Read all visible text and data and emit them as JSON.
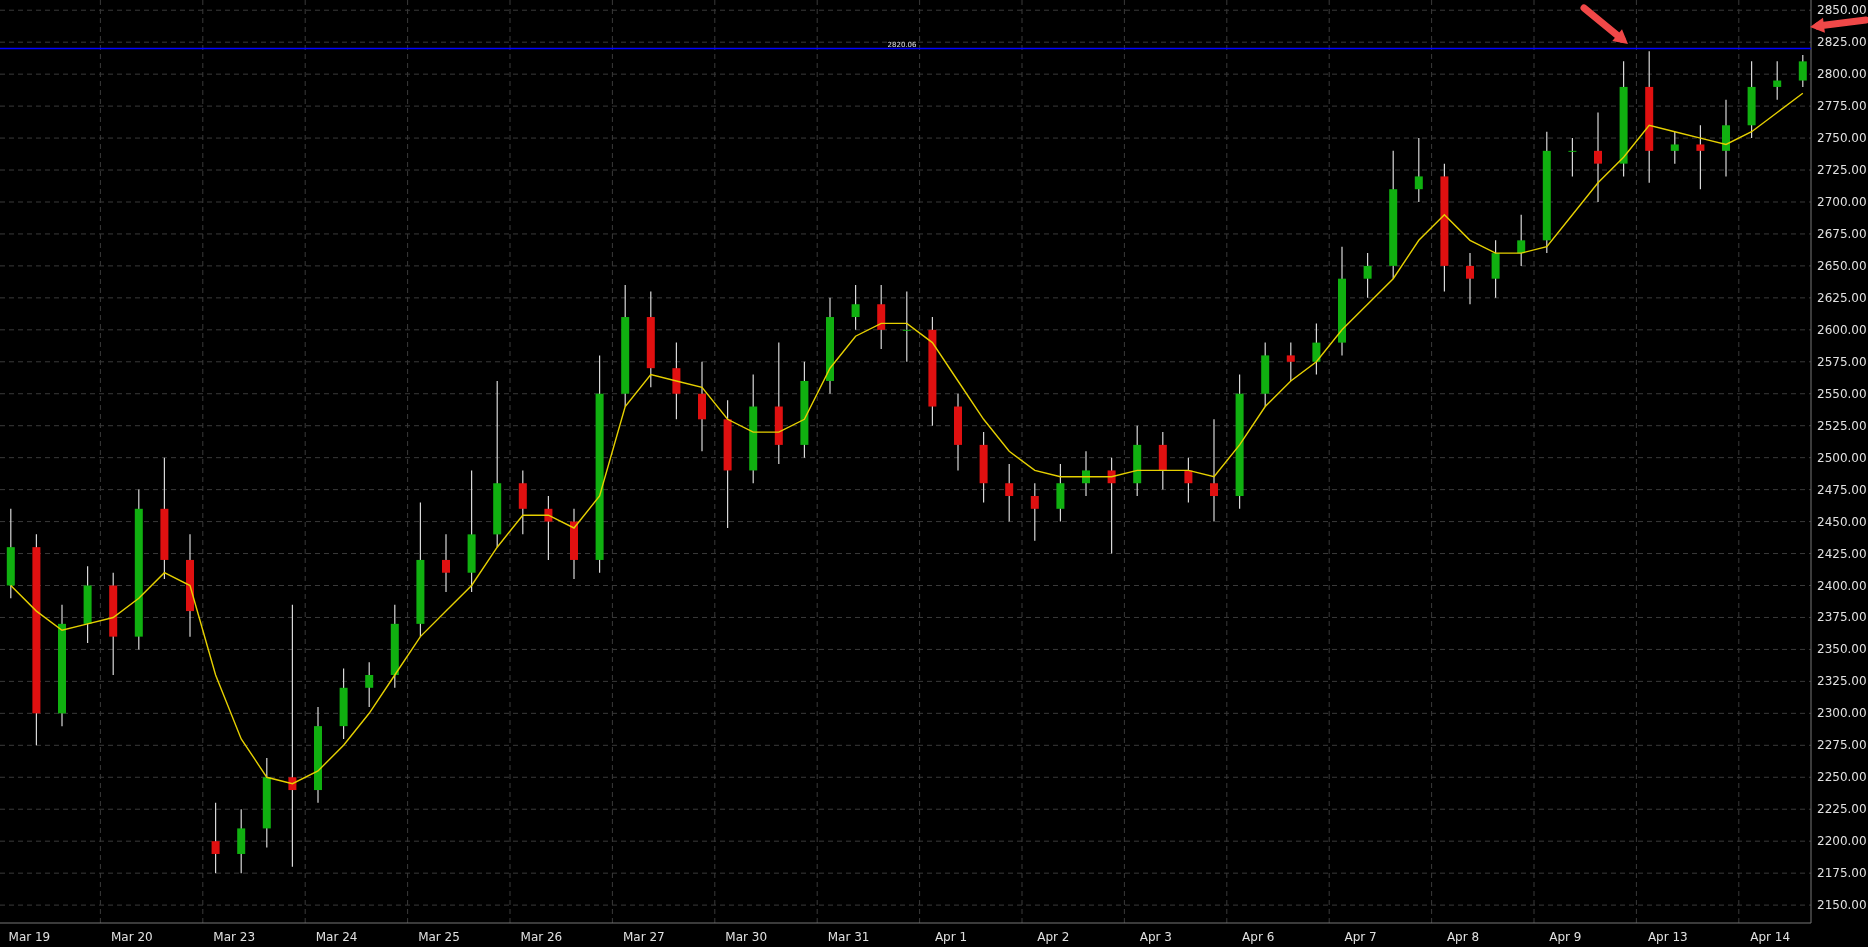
{
  "chart": {
    "chart_data": {
      "type": "candlestick",
      "grid": true,
      "ylim": [
        2136,
        2858
      ],
      "yticks": [
        {
          "value": 2150,
          "label": "2150.00"
        },
        {
          "value": 2175,
          "label": "2175.00"
        },
        {
          "value": 2200,
          "label": "2200.00"
        },
        {
          "value": 2225,
          "label": "2225.00"
        },
        {
          "value": 2250,
          "label": "2250.00"
        },
        {
          "value": 2275,
          "label": "2275.00"
        },
        {
          "value": 2300,
          "label": "2300.00"
        },
        {
          "value": 2325,
          "label": "2325.00"
        },
        {
          "value": 2350,
          "label": "2350.00"
        },
        {
          "value": 2375,
          "label": "2375.00"
        },
        {
          "value": 2400,
          "label": "2400.00"
        },
        {
          "value": 2425,
          "label": "2425.00"
        },
        {
          "value": 2450,
          "label": "2450.00"
        },
        {
          "value": 2475,
          "label": "2475.00"
        },
        {
          "value": 2500,
          "label": "2500.00"
        },
        {
          "value": 2525,
          "label": "2525.00"
        },
        {
          "value": 2550,
          "label": "2550.00"
        },
        {
          "value": 2575,
          "label": "2575.00"
        },
        {
          "value": 2600,
          "label": "2600.00"
        },
        {
          "value": 2625,
          "label": "2625.00"
        },
        {
          "value": 2650,
          "label": "2650.00"
        },
        {
          "value": 2675,
          "label": "2675.00"
        },
        {
          "value": 2700,
          "label": "2700.00"
        },
        {
          "value": 2725,
          "label": "2725.00"
        },
        {
          "value": 2750,
          "label": "2750.00"
        },
        {
          "value": 2775,
          "label": "2775.00"
        },
        {
          "value": 2800,
          "label": "2800.00"
        },
        {
          "value": 2825,
          "label": "2825.00"
        },
        {
          "value": 2850,
          "label": "2850.00"
        }
      ],
      "categories": [
        null,
        "Mar 19",
        null,
        null,
        null,
        "Mar 20",
        null,
        null,
        null,
        "Mar 23",
        null,
        null,
        null,
        "Mar 24",
        null,
        null,
        null,
        "Mar 25",
        null,
        null,
        null,
        "Mar 26",
        null,
        null,
        null,
        "Mar 27",
        null,
        null,
        null,
        "Mar 30",
        null,
        null,
        null,
        "Mar 31",
        null,
        null,
        null,
        "Apr 1",
        null,
        null,
        null,
        "Apr 2",
        null,
        null,
        null,
        "Apr 3",
        null,
        null,
        null,
        "Apr 6",
        null,
        null,
        null,
        "Apr 7",
        null,
        null,
        null,
        "Apr 8",
        null,
        null,
        null,
        "Apr 9",
        null,
        null,
        null,
        "Apr 13",
        null,
        null,
        null,
        "Apr 14",
        null
      ],
      "ohlc": [
        [
          2400,
          2460,
          2390,
          2430
        ],
        [
          2430,
          2440,
          2275,
          2300
        ],
        [
          2300,
          2385,
          2290,
          2370
        ],
        [
          2370,
          2415,
          2355,
          2400
        ],
        [
          2400,
          2410,
          2330,
          2360
        ],
        [
          2360,
          2475,
          2350,
          2460
        ],
        [
          2460,
          2500,
          2405,
          2420
        ],
        [
          2420,
          2440,
          2360,
          2380
        ],
        [
          2200,
          2230,
          2175,
          2190
        ],
        [
          2190,
          2225,
          2175,
          2210
        ],
        [
          2210,
          2265,
          2195,
          2250
        ],
        [
          2250,
          2385,
          2180,
          2240
        ],
        [
          2240,
          2305,
          2230,
          2290
        ],
        [
          2290,
          2335,
          2280,
          2320
        ],
        [
          2320,
          2340,
          2305,
          2330
        ],
        [
          2330,
          2385,
          2320,
          2370
        ],
        [
          2370,
          2465,
          2360,
          2420
        ],
        [
          2420,
          2440,
          2395,
          2410
        ],
        [
          2410,
          2490,
          2395,
          2440
        ],
        [
          2440,
          2560,
          2430,
          2480
        ],
        [
          2480,
          2490,
          2440,
          2460
        ],
        [
          2460,
          2470,
          2420,
          2450
        ],
        [
          2450,
          2460,
          2405,
          2420
        ],
        [
          2420,
          2580,
          2410,
          2550
        ],
        [
          2550,
          2635,
          2540,
          2610
        ],
        [
          2610,
          2630,
          2555,
          2570
        ],
        [
          2570,
          2590,
          2530,
          2550
        ],
        [
          2550,
          2575,
          2505,
          2530
        ],
        [
          2530,
          2545,
          2445,
          2490
        ],
        [
          2490,
          2565,
          2480,
          2540
        ],
        [
          2540,
          2590,
          2495,
          2510
        ],
        [
          2510,
          2575,
          2500,
          2560
        ],
        [
          2560,
          2625,
          2550,
          2610
        ],
        [
          2610,
          2635,
          2600,
          2620
        ],
        [
          2620,
          2635,
          2585,
          2600
        ],
        [
          2600,
          2630,
          2575,
          2600
        ],
        [
          2600,
          2610,
          2525,
          2540
        ],
        [
          2540,
          2550,
          2490,
          2510
        ],
        [
          2510,
          2520,
          2465,
          2480
        ],
        [
          2480,
          2495,
          2450,
          2470
        ],
        [
          2470,
          2480,
          2435,
          2460
        ],
        [
          2460,
          2495,
          2450,
          2480
        ],
        [
          2480,
          2505,
          2470,
          2490
        ],
        [
          2490,
          2500,
          2425,
          2480
        ],
        [
          2480,
          2525,
          2470,
          2510
        ],
        [
          2510,
          2520,
          2475,
          2490
        ],
        [
          2490,
          2500,
          2465,
          2480
        ],
        [
          2480,
          2530,
          2450,
          2470
        ],
        [
          2470,
          2565,
          2460,
          2550
        ],
        [
          2550,
          2590,
          2540,
          2580
        ],
        [
          2580,
          2590,
          2560,
          2575
        ],
        [
          2575,
          2605,
          2565,
          2590
        ],
        [
          2590,
          2665,
          2580,
          2640
        ],
        [
          2640,
          2660,
          2625,
          2650
        ],
        [
          2650,
          2740,
          2640,
          2710
        ],
        [
          2710,
          2750,
          2700,
          2720
        ],
        [
          2720,
          2730,
          2630,
          2650
        ],
        [
          2650,
          2660,
          2620,
          2640
        ],
        [
          2640,
          2670,
          2625,
          2660
        ],
        [
          2660,
          2690,
          2650,
          2670
        ],
        [
          2670,
          2755,
          2660,
          2740
        ],
        [
          2740,
          2750,
          2720,
          2740
        ],
        [
          2740,
          2770,
          2700,
          2730
        ],
        [
          2730,
          2810,
          2720,
          2790
        ],
        [
          2790,
          2818,
          2715,
          2740
        ],
        [
          2740,
          2755,
          2730,
          2745
        ],
        [
          2745,
          2760,
          2710,
          2740
        ],
        [
          2740,
          2780,
          2720,
          2760
        ],
        [
          2760,
          2810,
          2750,
          2790
        ],
        [
          2790,
          2810,
          2780,
          2795
        ],
        [
          2795,
          2815,
          2790,
          2810
        ]
      ],
      "series": [
        {
          "type": "line",
          "color": "#e6d000",
          "values": [
            2400,
            2380,
            2365,
            2370,
            2375,
            2390,
            2410,
            2400,
            2330,
            2280,
            2250,
            2245,
            2255,
            2275,
            2300,
            2330,
            2360,
            2380,
            2400,
            2430,
            2455,
            2455,
            2445,
            2470,
            2540,
            2565,
            2560,
            2555,
            2530,
            2520,
            2520,
            2530,
            2570,
            2595,
            2605,
            2605,
            2590,
            2560,
            2530,
            2505,
            2490,
            2485,
            2485,
            2485,
            2490,
            2490,
            2490,
            2485,
            2510,
            2540,
            2560,
            2575,
            2600,
            2620,
            2640,
            2670,
            2690,
            2670,
            2660,
            2660,
            2665,
            2690,
            2715,
            2735,
            2760,
            2755,
            2750,
            2745,
            2755,
            2770,
            2785
          ]
        }
      ],
      "ref_lines": [
        {
          "axis": "y",
          "value": 2820.06,
          "label": "2820.06",
          "color": "#0000ff"
        }
      ]
    },
    "markers": [
      {
        "kind": "arrow-down-right"
      },
      {
        "kind": "arrow-down-left"
      }
    ]
  }
}
